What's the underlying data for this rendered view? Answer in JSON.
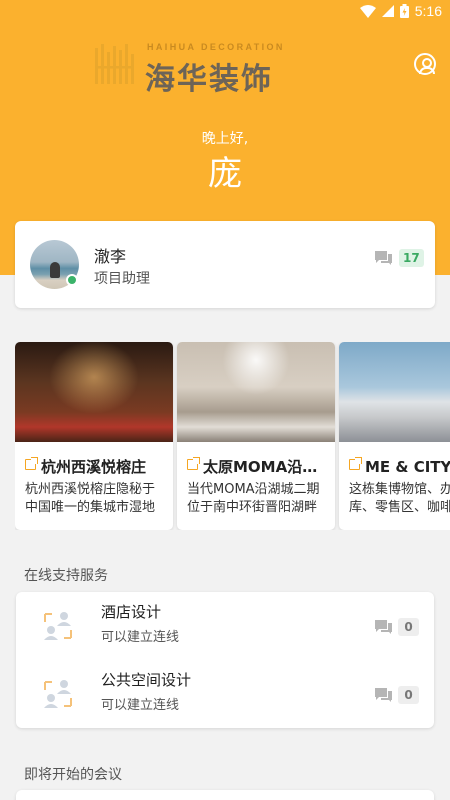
{
  "status_bar": {
    "time": "5:16"
  },
  "header": {
    "logo_sub": "HAIHUA DECORATION",
    "logo_main": "海华装饰",
    "greeting": "晚上好,",
    "username": "庞"
  },
  "user_card": {
    "name": "澈李",
    "role": "项目助理",
    "message_count": "17"
  },
  "projects": [
    {
      "title": "杭州西溪悦榕庄",
      "desc": "杭州西溪悦榕庄隐秘于中国唯一的集城市湿地"
    },
    {
      "title": "太原MOMA沿湖城",
      "desc": "当代MOMA沿湖城二期位于南中环街晋阳湖畔"
    },
    {
      "title": "ME & CITY设计",
      "desc": "这栋集博物馆、办公库、零售区、咖啡厅"
    }
  ],
  "sections": {
    "services_title": "在线支持服务",
    "meetings_title": "即将开始的会议"
  },
  "services": [
    {
      "name": "酒店设计",
      "sub": "可以建立连线",
      "count": "0"
    },
    {
      "name": "公共空间设计",
      "sub": "可以建立连线",
      "count": "0"
    }
  ],
  "colors": {
    "header_bg": "#FBB12E",
    "accent_link": "#F5A623",
    "online": "#3BB36A"
  }
}
